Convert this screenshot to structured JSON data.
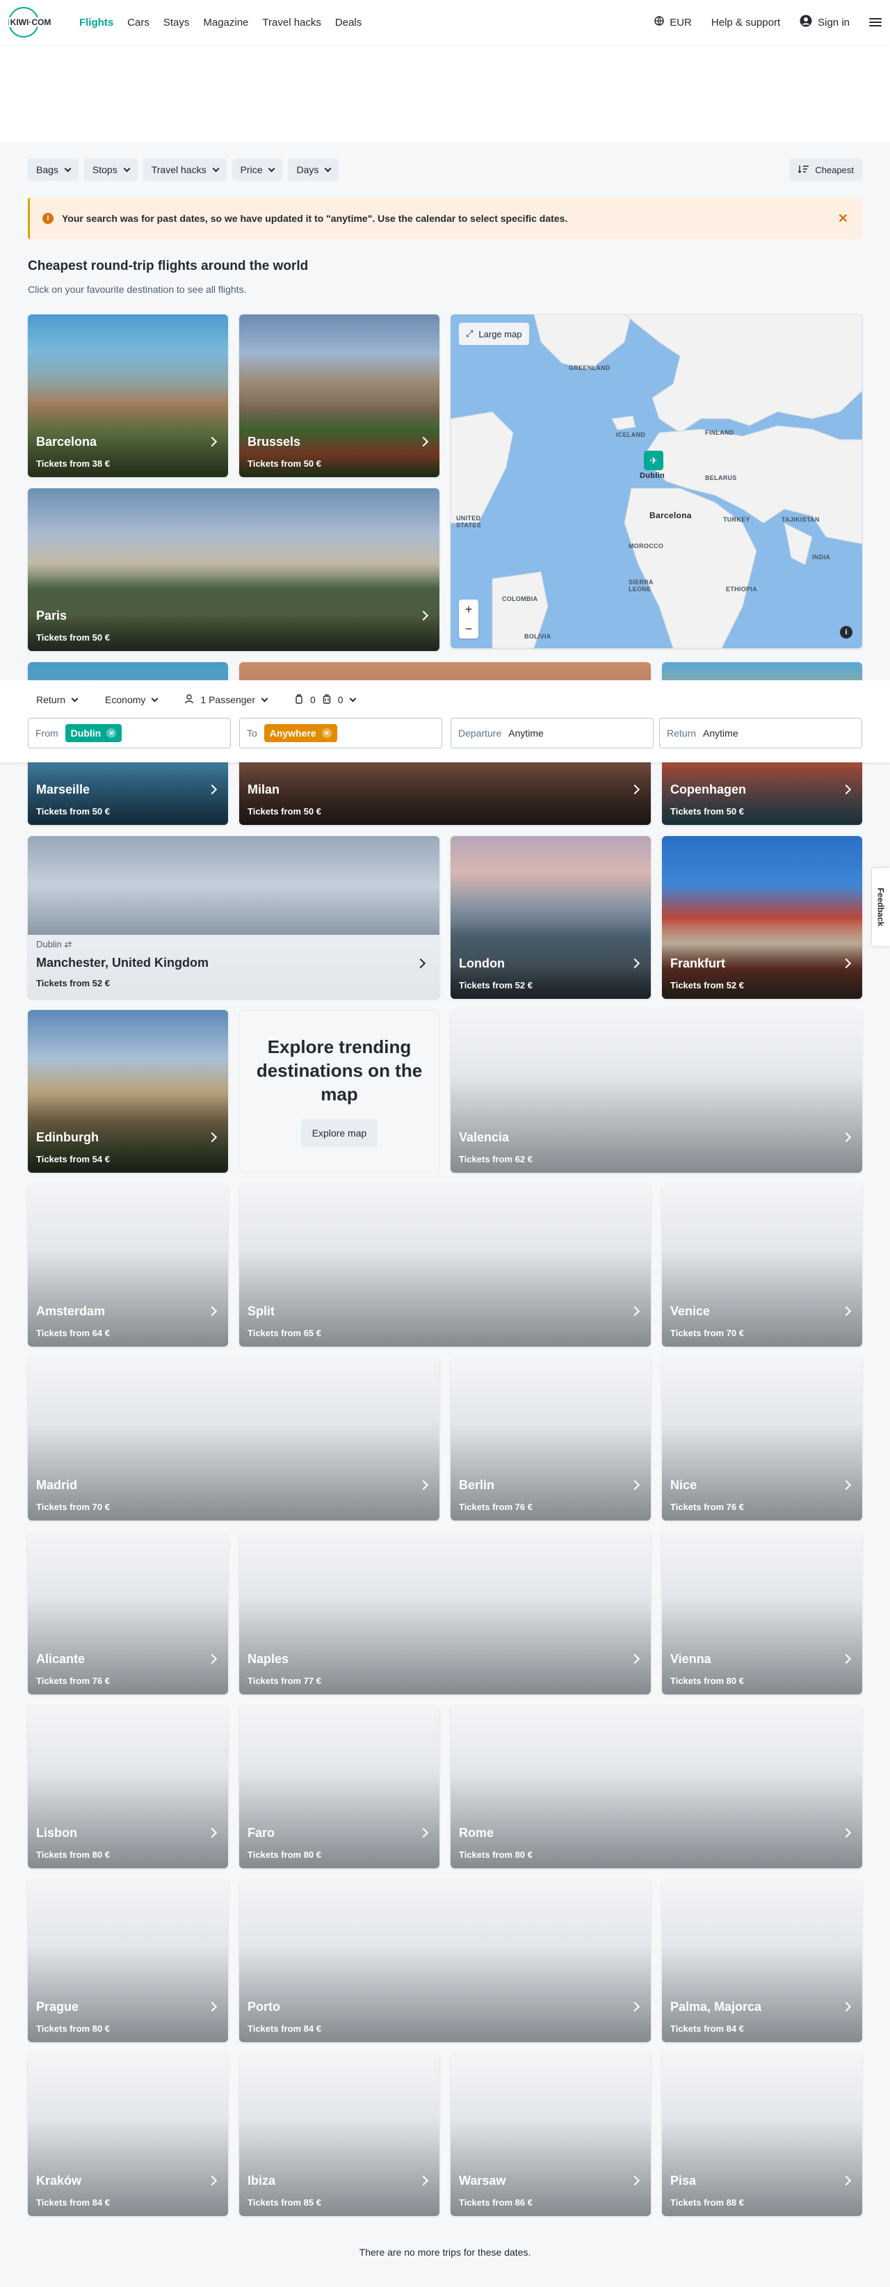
{
  "nav": {
    "logo_text": "KIWI·COM",
    "links": [
      "Flights",
      "Cars",
      "Stays",
      "Magazine",
      "Travel hacks",
      "Deals"
    ],
    "currency": "EUR",
    "help": "Help & support",
    "signin": "Sign in"
  },
  "filters": [
    "Bags",
    "Stops",
    "Travel hacks",
    "Price",
    "Days"
  ],
  "sort": "Cheapest",
  "alert": {
    "text": "Your search was for past dates, so we have updated it to \"anytime\". Use the calendar to select specific dates."
  },
  "title": "Cheapest round-trip flights around the world",
  "subtitle": "Click on your favourite destination to see all flights.",
  "map": {
    "large_map": "Large map",
    "labels": [
      "GREENLAND",
      "ICELAND",
      "FINLAND",
      "BELARUS",
      "Dublin",
      "Barcelona",
      "UNITED STATES",
      "MOROCCO",
      "TURKEY",
      "TAJIKISTAN",
      "INDIA",
      "COLOMBIA",
      "SIERRA LEONE",
      "ETHIOPIA",
      "BOLIVIA"
    ]
  },
  "search": {
    "trip_type": "Return",
    "cabin": "Economy",
    "passengers": "1 Passenger",
    "bags_cabin": "0",
    "bags_checked": "0",
    "from_label": "From",
    "from_value": "Dublin",
    "to_label": "To",
    "to_value": "Anywhere",
    "departure_label": "Departure",
    "departure_value": "Anytime",
    "return_label": "Return",
    "return_value": "Anytime"
  },
  "destinations": [
    {
      "name": "Barcelona",
      "price": "Tickets from 38 €"
    },
    {
      "name": "Brussels",
      "price": "Tickets from 50 €"
    },
    {
      "name": "Paris",
      "price": "Tickets from 50 €"
    },
    {
      "name": "Marseille",
      "price": "Tickets from 50 €"
    },
    {
      "name": "Milan",
      "price": "Tickets from 50 €"
    },
    {
      "name": "Copenhagen",
      "price": "Tickets from 50 €"
    },
    {
      "name": "Manchester, United Kingdom",
      "price": "Tickets from 52 €",
      "from": "Dublin"
    },
    {
      "name": "London",
      "price": "Tickets from 52 €"
    },
    {
      "name": "Frankfurt",
      "price": "Tickets from 52 €"
    },
    {
      "name": "Edinburgh",
      "price": "Tickets from 54 €"
    },
    {
      "name": "Valencia",
      "price": "Tickets from 62 €"
    },
    {
      "name": "Amsterdam",
      "price": "Tickets from 64 €"
    },
    {
      "name": "Split",
      "price": "Tickets from 65 €"
    },
    {
      "name": "Venice",
      "price": "Tickets from 70 €"
    },
    {
      "name": "Madrid",
      "price": "Tickets from 70 €"
    },
    {
      "name": "Berlin",
      "price": "Tickets from 76 €"
    },
    {
      "name": "Nice",
      "price": "Tickets from 76 €"
    },
    {
      "name": "Alicante",
      "price": "Tickets from 76 €"
    },
    {
      "name": "Naples",
      "price": "Tickets from 77 €"
    },
    {
      "name": "Vienna",
      "price": "Tickets from 80 €"
    },
    {
      "name": "Lisbon",
      "price": "Tickets from 80 €"
    },
    {
      "name": "Faro",
      "price": "Tickets from 80 €"
    },
    {
      "name": "Rome",
      "price": "Tickets from 80 €"
    },
    {
      "name": "Prague",
      "price": "Tickets from 80 €"
    },
    {
      "name": "Porto",
      "price": "Tickets from 84 €"
    },
    {
      "name": "Palma, Majorca",
      "price": "Tickets from 84 €"
    },
    {
      "name": "Kraków",
      "price": "Tickets from 84 €"
    },
    {
      "name": "Ibiza",
      "price": "Tickets from 85 €"
    },
    {
      "name": "Warsaw",
      "price": "Tickets from 86 €"
    },
    {
      "name": "Pisa",
      "price": "Tickets from 88 €"
    }
  ],
  "explore": {
    "heading": "Explore trending destinations on the map",
    "button": "Explore map"
  },
  "feedback": "Feedback",
  "footer_note": "There are no more trips for these dates.",
  "colors": {
    "brand": "#00a991",
    "from_tag": "#00a991",
    "to_tag": "#e28a00",
    "alert_bg": "#fdf0e3"
  }
}
